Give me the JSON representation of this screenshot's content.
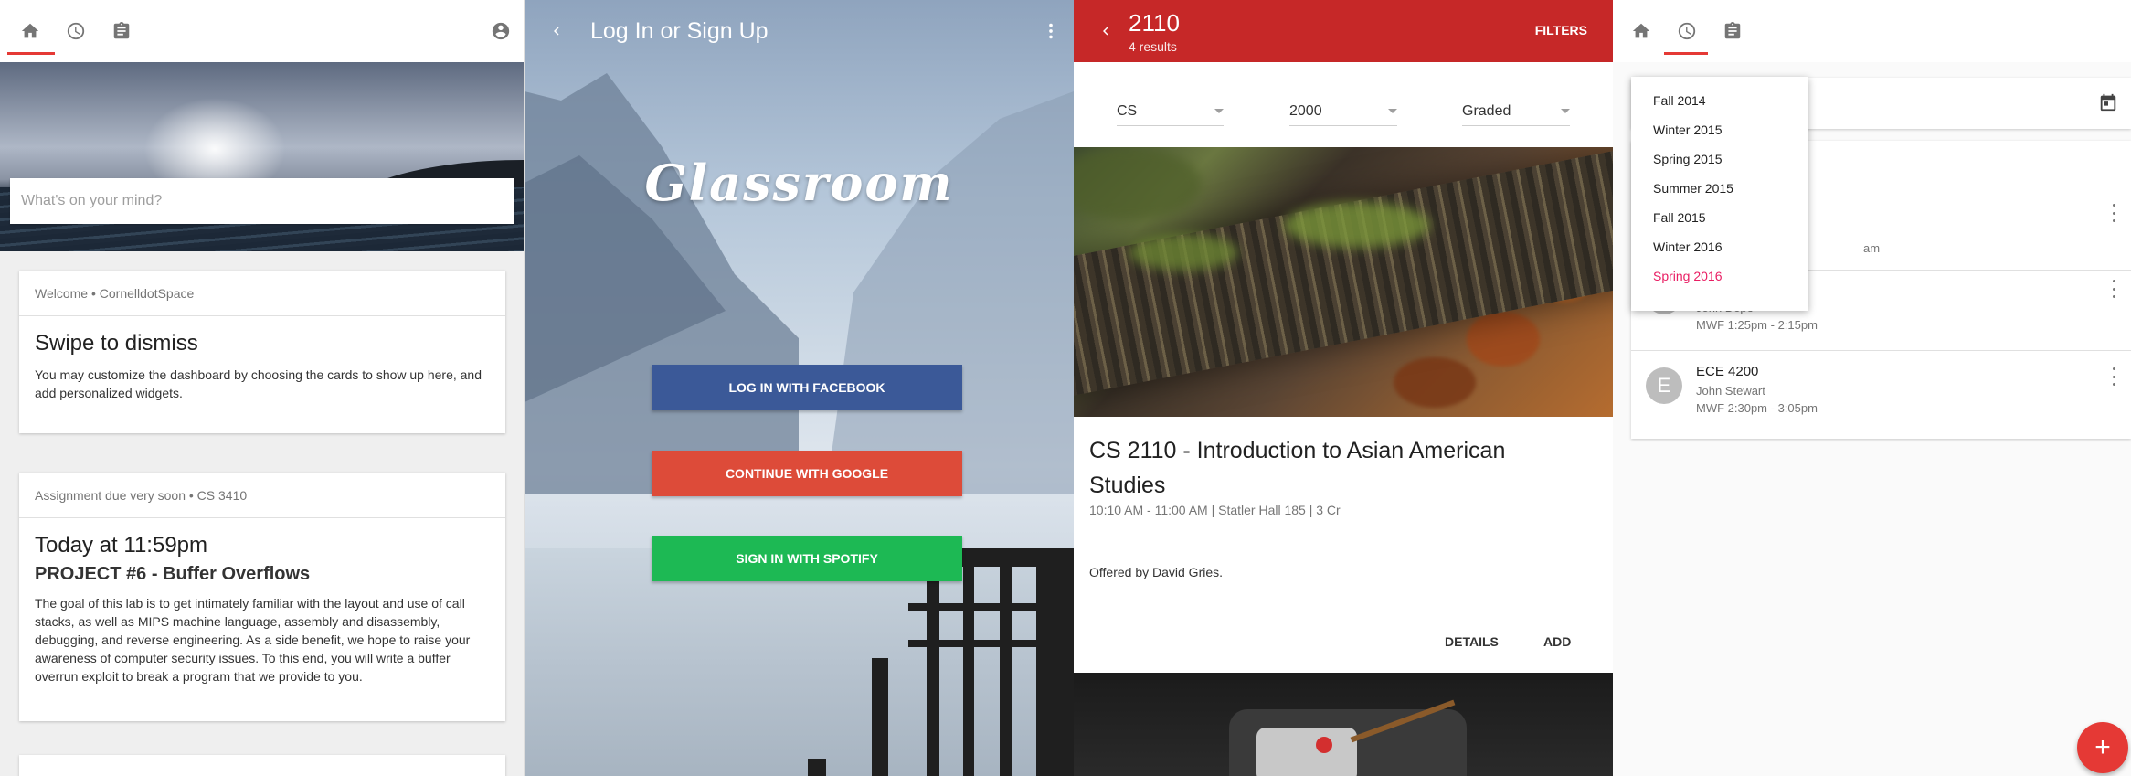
{
  "dashboard": {
    "nav_icons": [
      "home-icon",
      "history-icon",
      "assignment-icon",
      "account-icon"
    ],
    "active_tab": "home",
    "composer_placeholder": "What's on your mind?",
    "welcome_card": {
      "header": "Welcome • CornelldotSpace",
      "title": "Swipe to dismiss",
      "body": "You may customize the dashboard by choosing the cards to show up here, and add personalized widgets."
    },
    "assignment_card": {
      "header": "Assignment due very soon • CS 3410",
      "time": "Today at 11:59pm",
      "project": "PROJECT #6 - Buffer Overflows",
      "body": "The goal of this lab is to get intimately familiar with the layout and use of call stacks, as well as MIPS machine language, assembly and disassembly, debugging, and reverse engineering. As a side benefit, we hope to raise your awareness of computer security issues. To this end, you will write a buffer overrun exploit to break a program that we provide to you."
    }
  },
  "login": {
    "title": "Log In or Sign Up",
    "logo_text": "Glassroom",
    "buttons": [
      {
        "label": "LOG IN WITH FACEBOOK",
        "color": "#3b5998"
      },
      {
        "label": "CONTINUE WITH GOOGLE",
        "color": "#dd4b39"
      },
      {
        "label": "SIGN IN WITH SPOTIFY",
        "color": "#1db954"
      }
    ]
  },
  "search": {
    "query": "2110",
    "results_count": "4 results",
    "filters_label": "FILTERS",
    "accent": "#c62828",
    "dropdowns": [
      {
        "value": "CS"
      },
      {
        "value": "2000"
      },
      {
        "value": "Graded"
      }
    ],
    "course": {
      "title": "CS 2110 - Introduction to Asian American Studies",
      "meta": "10:10 AM - 11:00 AM | Statler Hall 185 | 3 Cr",
      "offered_by": "Offered by David Gries.",
      "details_label": "DETAILS",
      "add_label": "ADD"
    }
  },
  "schedule": {
    "active_tab": "history",
    "semester_menu": [
      {
        "label": "Fall 2014",
        "selected": false
      },
      {
        "label": "Winter 2015",
        "selected": false
      },
      {
        "label": "Spring 2015",
        "selected": false
      },
      {
        "label": "Summer 2015",
        "selected": false
      },
      {
        "label": "Fall 2015",
        "selected": false
      },
      {
        "label": "Winter 2016",
        "selected": false
      },
      {
        "label": "Spring 2016",
        "selected": true
      }
    ],
    "selected_color": "#e91e63",
    "classes": [
      {
        "avatar": "",
        "name": "",
        "instructor": "",
        "time": "am"
      },
      {
        "avatar": "",
        "name": "",
        "instructor": "John Dope",
        "time": "MWF 1:25pm - 2:15pm"
      },
      {
        "avatar": "E",
        "name": "ECE 4200",
        "instructor": "John Stewart",
        "time": "MWF 2:30pm - 3:05pm"
      }
    ],
    "fab_label": "+"
  }
}
